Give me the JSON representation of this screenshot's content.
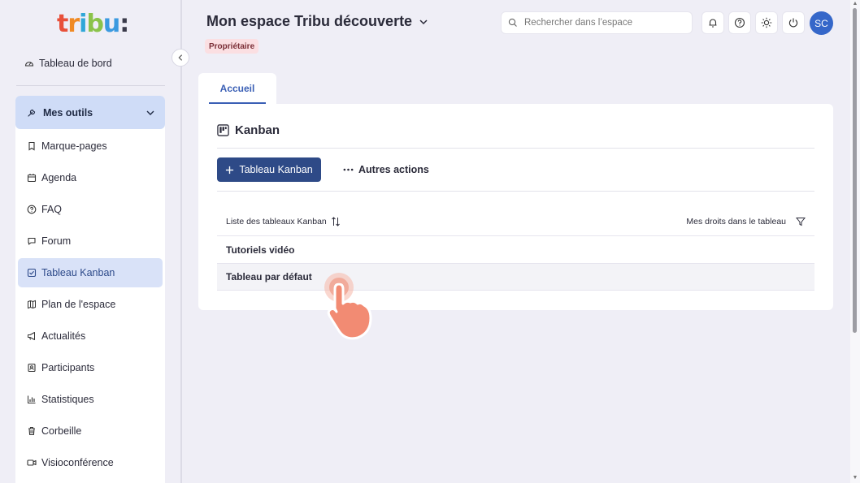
{
  "app": {
    "logo_letters": [
      "t",
      "r",
      "i",
      "b",
      "u",
      ":"
    ],
    "logo_colors": [
      "#e8503a",
      "#f08a24",
      "#2fa7d8",
      "#8bc34a",
      "#3b9ae0",
      "#3a3a4a"
    ]
  },
  "sidebar": {
    "dashboard_label": "Tableau de bord",
    "tools_label": "Mes outils",
    "items": [
      {
        "label": "Marque-pages",
        "icon": "bookmark-icon"
      },
      {
        "label": "Agenda",
        "icon": "calendar-icon"
      },
      {
        "label": "FAQ",
        "icon": "question-icon"
      },
      {
        "label": "Forum",
        "icon": "chat-icon"
      },
      {
        "label": "Tableau Kanban",
        "icon": "checkbox-icon",
        "active": true
      },
      {
        "label": "Plan de l'espace",
        "icon": "map-icon"
      },
      {
        "label": "Actualités",
        "icon": "megaphone-icon"
      },
      {
        "label": "Participants",
        "icon": "contact-icon"
      },
      {
        "label": "Statistiques",
        "icon": "bar-chart-icon"
      },
      {
        "label": "Corbeille",
        "icon": "trash-icon"
      },
      {
        "label": "Visioconférence",
        "icon": "video-icon"
      }
    ]
  },
  "header": {
    "title": "Mon espace Tribu découverte",
    "role_badge": "Propriétaire",
    "search_placeholder": "Rechercher dans l’espace",
    "avatar_initials": "SC"
  },
  "tabs": [
    {
      "label": "Accueil",
      "active": true
    }
  ],
  "kanban": {
    "title": "Kanban",
    "add_button": "Tableau Kanban",
    "more_actions": "Autres actions",
    "col_list": "Liste des tableaux Kanban",
    "col_rights": "Mes droits dans le tableau",
    "rows": [
      "Tutoriels vidéo",
      "Tableau par défaut"
    ]
  },
  "colors": {
    "accent": "#3a5fb5",
    "primary_button": "#2e4a87",
    "avatar": "#3567c9",
    "badge_bg": "#fbdfe2",
    "active_nav": "#d9e2f8",
    "tools_head": "#cfdcf7",
    "pointer": "#f0826a"
  }
}
